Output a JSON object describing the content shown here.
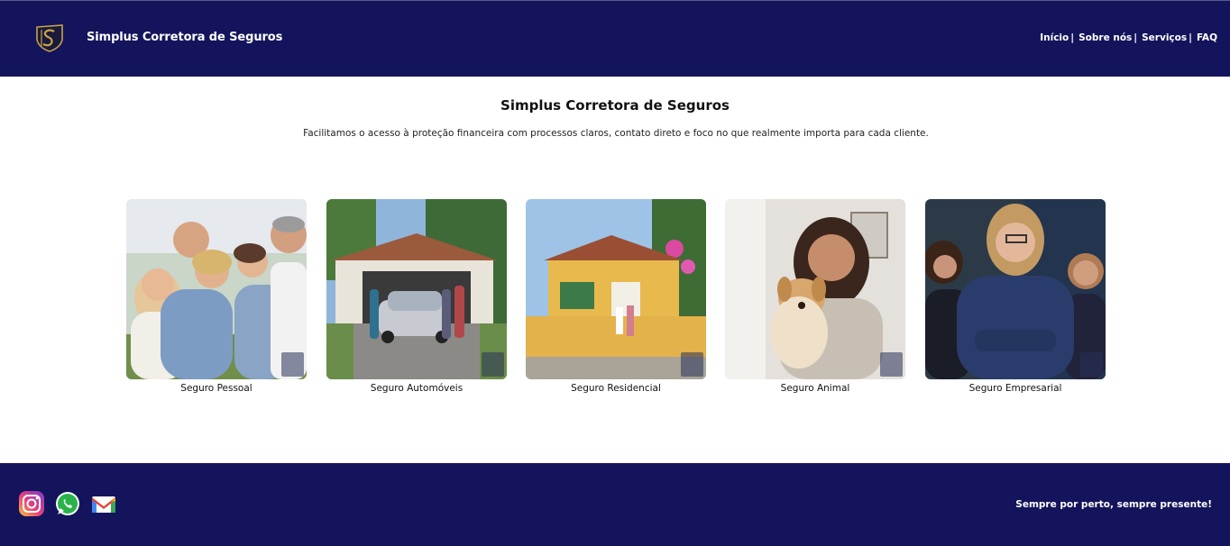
{
  "header": {
    "brand": "Simplus Corretora de Seguros",
    "nav": [
      {
        "label": "Início",
        "sep": "|"
      },
      {
        "label": "Sobre nós",
        "sep": "|"
      },
      {
        "label": "Serviços",
        "sep": "|"
      },
      {
        "label": "FAQ",
        "sep": ""
      }
    ]
  },
  "hero": {
    "title": "Simplus Corretora de Seguros",
    "subtitle": "Facilitamos o acesso à proteção financeira com processos claros, contato direto e foco no que realmente importa para cada cliente."
  },
  "cards": [
    {
      "label": "Seguro Pessoal",
      "icon": "family-photo"
    },
    {
      "label": "Seguro Automóveis",
      "icon": "car-garage-photo"
    },
    {
      "label": "Seguro Residencial",
      "icon": "house-photo"
    },
    {
      "label": "Seguro Animal",
      "icon": "dog-owner-photo"
    },
    {
      "label": "Seguro Empresarial",
      "icon": "business-team-photo"
    }
  ],
  "footer": {
    "slogan": "Sempre por perto, sempre presente!",
    "social": [
      "instagram-icon",
      "whatsapp-icon",
      "gmail-icon"
    ]
  },
  "colors": {
    "header_bg": "#14145c",
    "footer_bg": "#14145c",
    "logo_gold": "#c9a24a"
  }
}
